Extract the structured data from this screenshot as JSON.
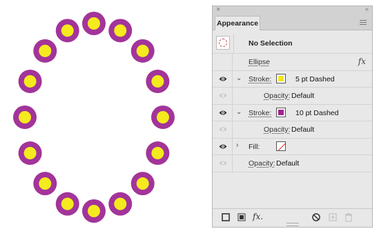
{
  "panel": {
    "tab_label": "Appearance",
    "selection_label": "No Selection",
    "fx_symbol": "fx",
    "icons": [
      "close-icon",
      "collapse-icon",
      "panel-menu-icon",
      "eye-icon",
      "chevron-down-icon",
      "chevron-right-icon"
    ]
  },
  "rows": {
    "ellipse": {
      "label": "Ellipse"
    },
    "stroke1": {
      "label": "Stroke:",
      "value": "5 pt Dashed",
      "color": "#f5e51f",
      "visible": true,
      "expanded": true
    },
    "stroke1_opacity": {
      "label": "Opacity:",
      "value": "Default",
      "visible": false
    },
    "stroke2": {
      "label": "Stroke:",
      "value": "10 pt Dashed",
      "color": "#a3228f",
      "visible": true,
      "expanded": true
    },
    "stroke2_opacity": {
      "label": "Opacity:",
      "value": "Default",
      "visible": false
    },
    "fill": {
      "label": "Fill:",
      "value": "none",
      "visible": true,
      "expanded": false
    },
    "opacity": {
      "label": "Opacity:",
      "value": "Default",
      "visible": false
    }
  },
  "footer": {
    "icons": [
      "add-new-stroke-icon",
      "add-new-fill-icon",
      "add-new-effect-icon",
      "clear-appearance-icon",
      "duplicate-item-icon",
      "delete-item-icon"
    ],
    "fx_label": "fx."
  },
  "artwork": {
    "outer_color": "#a3349a",
    "inner_color": "#f5ea1e",
    "dot_count": 16
  }
}
